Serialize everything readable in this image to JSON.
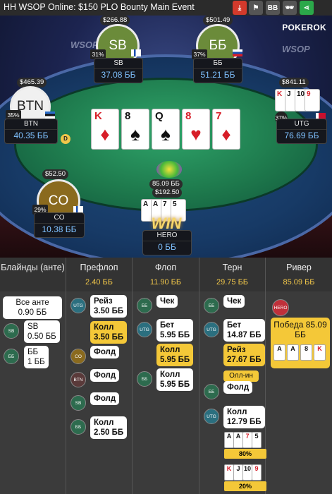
{
  "header": {
    "title": "HH WSOP Online: $150 PLO Bounty Main Event",
    "icons": [
      "download-icon",
      "flag-icon",
      "bb-icon",
      "incognito-icon",
      "share-icon"
    ],
    "bb_label": "BB"
  },
  "table": {
    "brand": "POKEROK",
    "board_cards": [
      {
        "rank": "K",
        "suit": "♦",
        "color": "red"
      },
      {
        "rank": "8",
        "suit": "♠",
        "color": "black"
      },
      {
        "rank": "Q",
        "suit": "♠",
        "color": "black"
      },
      {
        "rank": "8",
        "suit": "♥",
        "color": "red"
      },
      {
        "rank": "7",
        "suit": "♦",
        "color": "red"
      }
    ],
    "pot": "85.09 ББ",
    "win_label": "WIN",
    "seats": {
      "sb": {
        "avatar": "SB",
        "name": "SB",
        "stack": "37.08 ББ",
        "bounty": "$266.88",
        "pct": "31%"
      },
      "bb": {
        "avatar": "ББ",
        "name": "ББ",
        "stack": "51.21 ББ",
        "bounty": "$501.49",
        "pct": "37%"
      },
      "btn": {
        "avatar": "BTN",
        "name": "BTN",
        "stack": "40.35 ББ",
        "bounty": "$465.39",
        "pct": "35%"
      },
      "utg": {
        "name": "UTG",
        "stack": "76.69 ББ",
        "bounty": "$841.11",
        "pct": "37%",
        "cards": [
          {
            "r": "K",
            "c": "red"
          },
          {
            "r": "J",
            "c": "black"
          },
          {
            "r": "10",
            "c": "black"
          },
          {
            "r": "9",
            "c": "red"
          }
        ]
      },
      "co": {
        "avatar": "CO",
        "name": "CO",
        "stack": "10.38 ББ",
        "bounty": "$52.50",
        "pct": "29%"
      },
      "hero": {
        "name": "HERO",
        "stack": "0 ББ",
        "bounty": "$192.50",
        "cards": [
          {
            "r": "A",
            "c": "black"
          },
          {
            "r": "A",
            "c": "black"
          },
          {
            "r": "7",
            "c": "black"
          },
          {
            "r": "5",
            "c": "black"
          }
        ]
      }
    },
    "dealer": "D"
  },
  "grid": {
    "headers": [
      {
        "label": "Блайнды (анте)",
        "value": ""
      },
      {
        "label": "Префлоп",
        "value": "2.40 ББ"
      },
      {
        "label": "Флоп",
        "value": "11.90 ББ"
      },
      {
        "label": "Терн",
        "value": "29.75 ББ"
      },
      {
        "label": "Ривер",
        "value": "85.09 ББ"
      }
    ],
    "blinds": {
      "ante": "Все анте\n0.90 ББ",
      "sb_pos": "SB",
      "sb": "SB\n0.50 ББ",
      "bb_pos": "ББ",
      "bb": "ББ\n1 ББ"
    },
    "preflop": [
      {
        "pos": "UTG",
        "text": "Рейз\n3.50 ББ",
        "style": "w"
      },
      {
        "pos": "",
        "text": "Колл\n3.50 ББ",
        "style": "y"
      },
      {
        "pos": "CO",
        "text": "Фолд",
        "style": "w"
      },
      {
        "pos": "BTN",
        "text": "Фолд",
        "style": "w"
      },
      {
        "pos": "SB",
        "text": "Фолд",
        "style": "w"
      },
      {
        "pos": "ББ",
        "text": "Колл\n2.50 ББ",
        "style": "w"
      }
    ],
    "flop": [
      {
        "pos": "ББ",
        "text": "Чек"
      },
      {
        "pos": "UTG",
        "text": "Бет\n5.95 ББ"
      },
      {
        "pos": "",
        "text": "Колл\n5.95 ББ"
      },
      {
        "pos": "ББ",
        "text": "Колл\n5.95 ББ"
      }
    ],
    "turn": [
      {
        "pos": "ББ",
        "text": "Чек"
      },
      {
        "pos": "UTG",
        "text": "Бет\n14.87 ББ"
      },
      {
        "pos": "",
        "text": "Рейз\n27.67 ББ",
        "tag": "Олл-ин"
      },
      {
        "pos": "ББ",
        "text": "Фолд"
      },
      {
        "pos": "UTG",
        "text": "Колл\n12.79 ББ"
      }
    ],
    "turn_hero_equity": "80%",
    "turn_utg_equity": "20%",
    "river": {
      "pos": "HERO",
      "text": "Победа 85.09 ББ",
      "cards": [
        {
          "r": "A",
          "c": "black"
        },
        {
          "r": "A",
          "c": "black"
        },
        {
          "r": "8",
          "c": "black"
        },
        {
          "r": "K",
          "c": "red"
        }
      ]
    }
  }
}
